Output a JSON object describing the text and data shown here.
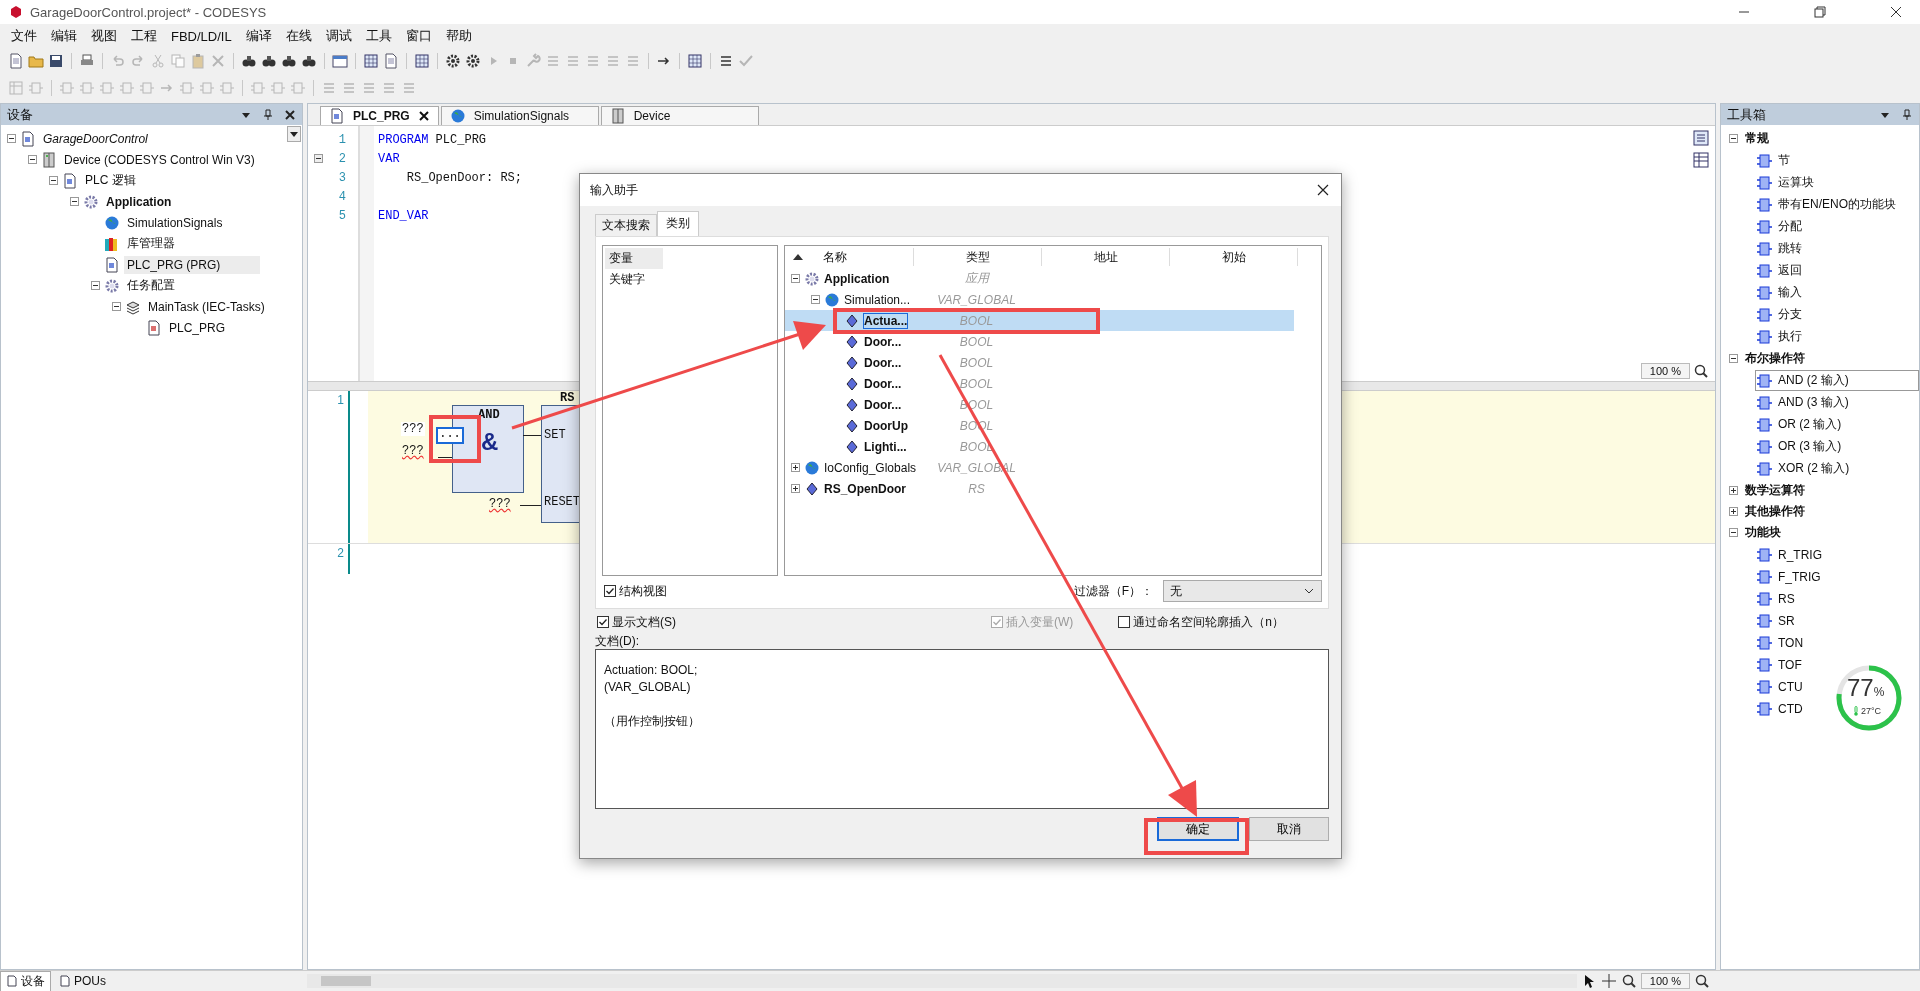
{
  "window": {
    "title": "GarageDoorControl.project* - CODESYS"
  },
  "menu": [
    "文件",
    "编辑",
    "视图",
    "工程",
    "FBD/LD/IL",
    "编译",
    "在线",
    "调试",
    "工具",
    "窗口",
    "帮助"
  ],
  "devices_panel": {
    "title": "设备",
    "tree": [
      {
        "label": "GarageDoorControl",
        "kind": "project",
        "selected": false,
        "expanded": true,
        "children": [
          {
            "label": "Device (CODESYS Control Win V3)",
            "kind": "device",
            "selected": false,
            "expanded": true,
            "children": [
              {
                "label": "PLC 逻辑",
                "kind": "plc",
                "selected": false,
                "expanded": true,
                "children": [
                  {
                    "label": "Application",
                    "kind": "application",
                    "selected": false,
                    "expanded": true,
                    "children": [
                      {
                        "label": "SimulationSignals",
                        "kind": "gvl",
                        "selected": false
                      },
                      {
                        "label": "库管理器",
                        "kind": "library",
                        "selected": false
                      },
                      {
                        "label": "PLC_PRG (PRG)",
                        "kind": "pou",
                        "selected": true
                      },
                      {
                        "label": "任务配置",
                        "kind": "tasks",
                        "selected": false,
                        "expanded": true,
                        "children": [
                          {
                            "label": "MainTask (IEC-Tasks)",
                            "kind": "task",
                            "selected": false,
                            "expanded": true,
                            "children": [
                              {
                                "label": "PLC_PRG",
                                "kind": "call",
                                "selected": false
                              }
                            ]
                          }
                        ]
                      }
                    ]
                  }
                ]
              }
            ]
          }
        ]
      }
    ]
  },
  "editor": {
    "tabs": [
      {
        "label": "PLC_PRG",
        "kind": "pou",
        "selected": true,
        "closable": true
      },
      {
        "label": "SimulationSignals",
        "kind": "gvl",
        "selected": false,
        "closable": false
      },
      {
        "label": "Device",
        "kind": "device",
        "selected": false,
        "closable": false
      }
    ],
    "declaration": [
      {
        "number": "1",
        "fold": false,
        "tokens": [
          {
            "text": "PROGRAM",
            "kind": "keyword"
          },
          {
            "text": " PLC_PRG",
            "kind": "plain"
          }
        ]
      },
      {
        "number": "2",
        "fold": true,
        "tokens": [
          {
            "text": "VAR",
            "kind": "keyword"
          }
        ]
      },
      {
        "number": "3",
        "fold": false,
        "tokens": [
          {
            "text": "    RS_OpenDoor: RS;",
            "kind": "plain"
          }
        ]
      },
      {
        "number": "4",
        "fold": false
      },
      {
        "number": "5",
        "fold": false,
        "tokens": [
          {
            "text": "END_VAR",
            "kind": "keyword"
          }
        ]
      }
    ],
    "zoom": "100 %",
    "networks": [
      "1",
      "2"
    ],
    "and_block": {
      "title": "AND",
      "symbol": "&",
      "inputs": [
        "???",
        "???"
      ],
      "edit_field": "..."
    },
    "rs_block": {
      "title": "RS",
      "pins": [
        "SET",
        "RESET"
      ],
      "reset_input": "???"
    }
  },
  "dialog": {
    "title": "输入助手",
    "tabs": [
      {
        "label": "文本搜索",
        "selected": false
      },
      {
        "label": "类别",
        "selected": true
      }
    ],
    "categories": [
      {
        "label": "变量",
        "selected": true
      },
      {
        "label": "关键字",
        "selected": false
      }
    ],
    "columns": [
      "名称",
      "类型",
      "地址",
      "初始"
    ],
    "tree": [
      {
        "name": "Application",
        "type": "应用",
        "kind": "application",
        "selected": false,
        "expanded": true,
        "children": [
          {
            "name": "Simulation...",
            "type": "VAR_GLOBAL",
            "kind": "gvl",
            "selected": false,
            "expanded": true,
            "children": [
              {
                "name": "Actua...",
                "type": "BOOL",
                "kind": "variable",
                "selected": true
              },
              {
                "name": "Door...",
                "type": "BOOL",
                "kind": "variable",
                "selected": false
              },
              {
                "name": "Door...",
                "type": "BOOL",
                "kind": "variable",
                "selected": false
              },
              {
                "name": "Door...",
                "type": "BOOL",
                "kind": "variable",
                "selected": false
              },
              {
                "name": "Door...",
                "type": "BOOL",
                "kind": "variable",
                "selected": false
              },
              {
                "name": "DoorUp",
                "type": "BOOL",
                "kind": "variable",
                "selected": false
              },
              {
                "name": "Lighti...",
                "type": "BOOL",
                "kind": "variable",
                "selected": false
              }
            ]
          }
        ]
      },
      {
        "name": "IoConfig_Globals",
        "type": "VAR_GLOBAL",
        "kind": "gvl",
        "selected": false,
        "expanded": false
      },
      {
        "name": "RS_OpenDoor",
        "type": "RS",
        "kind": "variable",
        "selected": false,
        "expanded": false
      }
    ],
    "structured_view": {
      "label": "结构视图",
      "checked": true
    },
    "filter": {
      "label": "过滤器（F）：",
      "value": "无"
    },
    "options": [
      {
        "label": "显示文档(S)",
        "checked": true,
        "disabled": false
      },
      {
        "label": "插入变量(W)",
        "checked": true,
        "disabled": true
      },
      {
        "label": "通过命名空间轮廓插入（n）",
        "checked": false,
        "disabled": false
      }
    ],
    "doc_label": "文档(D):",
    "documentation": "Actuation: BOOL;\n(VAR_GLOBAL)\n\n（用作控制按钮）",
    "buttons": [
      {
        "label": "确定",
        "default": true
      },
      {
        "label": "取消",
        "default": false
      }
    ]
  },
  "toolbox": {
    "title": "工具箱",
    "groups": [
      {
        "label": "常规",
        "expanded": true,
        "items": [
          {
            "label": "节",
            "selected": false
          },
          {
            "label": "运算块",
            "selected": false
          },
          {
            "label": "带有EN/ENO的功能块",
            "selected": false
          },
          {
            "label": "分配",
            "selected": false
          },
          {
            "label": "跳转",
            "selected": false
          },
          {
            "label": "返回",
            "selected": false
          },
          {
            "label": "输入",
            "selected": false
          },
          {
            "label": "分支",
            "selected": false
          },
          {
            "label": "执行",
            "selected": false
          }
        ]
      },
      {
        "label": "布尔操作符",
        "expanded": true,
        "items": [
          {
            "label": "AND (2 输入)",
            "selected": true
          },
          {
            "label": "AND (3 输入)",
            "selected": false
          },
          {
            "label": "OR (2 输入)",
            "selected": false
          },
          {
            "label": "OR (3 输入)",
            "selected": false
          },
          {
            "label": "XOR (2 输入)",
            "selected": false
          }
        ]
      },
      {
        "label": "数学运算符",
        "expanded": false
      },
      {
        "label": "其他操作符",
        "expanded": false
      },
      {
        "label": "功能块",
        "expanded": true,
        "items": [
          {
            "label": "R_TRIG",
            "selected": false
          },
          {
            "label": "F_TRIG",
            "selected": false
          },
          {
            "label": "RS",
            "selected": false
          },
          {
            "label": "SR",
            "selected": false
          },
          {
            "label": "TON",
            "selected": false
          },
          {
            "label": "TOF",
            "selected": false
          },
          {
            "label": "CTU",
            "selected": false
          },
          {
            "label": "CTD",
            "selected": false
          }
        ]
      }
    ]
  },
  "gauge": {
    "value": "77",
    "unit": "%",
    "temperature": "27°C",
    "level": 0.77
  },
  "status_bar": {
    "tabs": [
      {
        "label": "设备",
        "selected": true
      },
      {
        "label": "POUs",
        "selected": false
      }
    ],
    "zoom": "100 %"
  }
}
